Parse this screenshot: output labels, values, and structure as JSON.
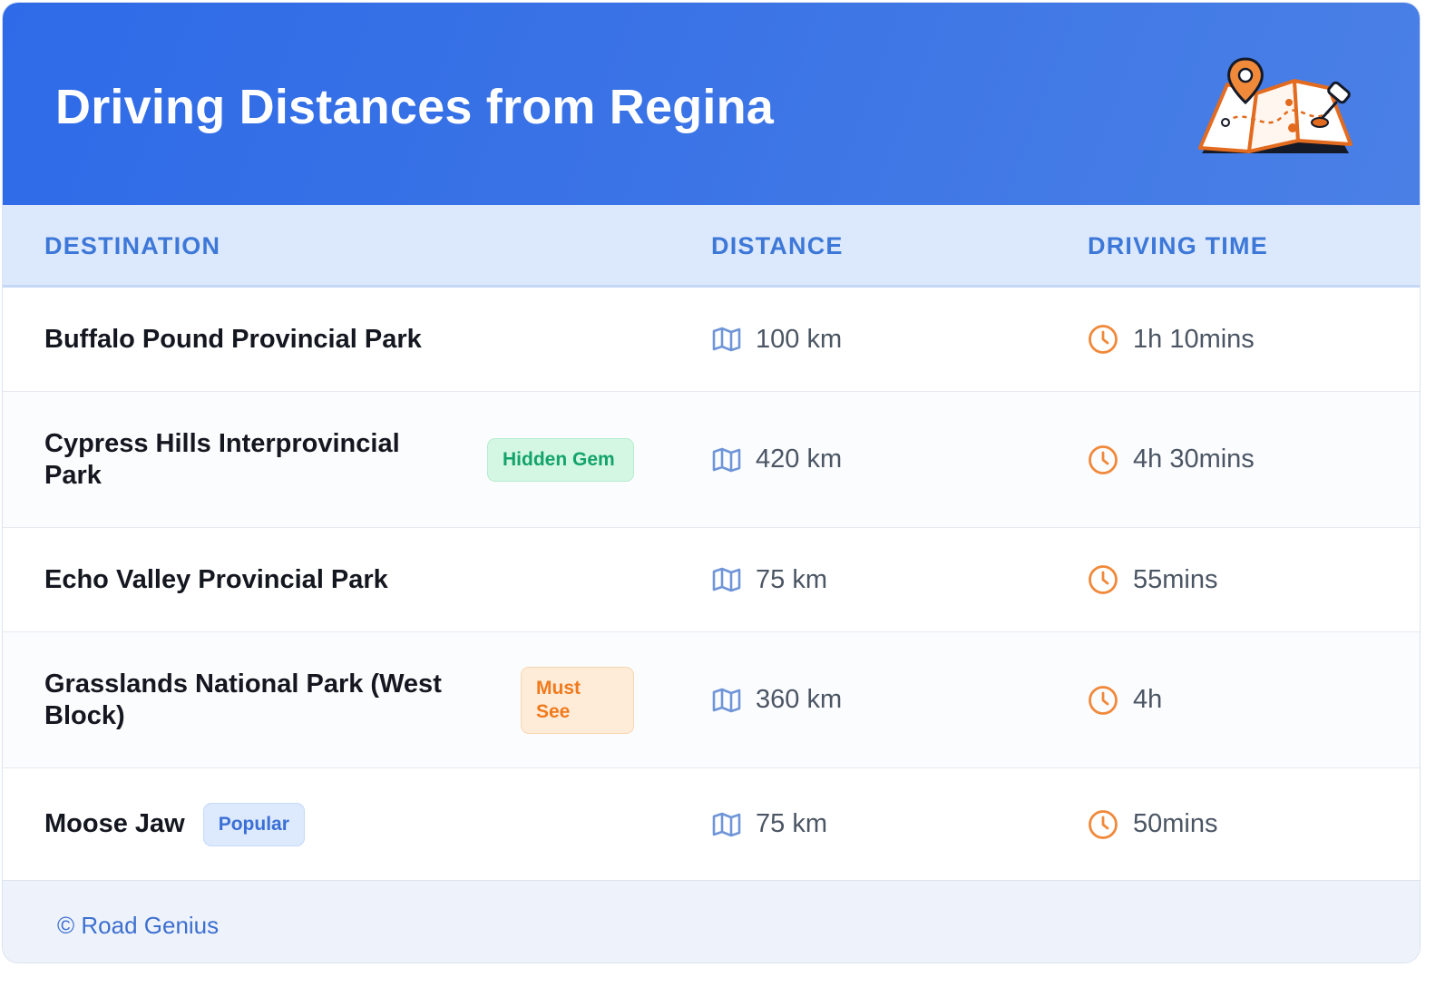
{
  "header": {
    "title": "Driving Distances from Regina",
    "illustration_icon": "folded-map-with-pin-icon",
    "gradient_start": "#2f6be8",
    "gradient_end": "#4a80e6"
  },
  "table": {
    "columns": {
      "destination": "DESTINATION",
      "distance": "DISTANCE",
      "driving_time": "DRIVING TIME"
    },
    "distance_icon": "map-icon",
    "time_icon": "clock-icon",
    "rows": [
      {
        "destination": "Buffalo Pound Provincial Park",
        "badge": null,
        "distance": "100 km",
        "driving_time": "1h 10mins"
      },
      {
        "destination": "Cypress Hills Interprovincial Park",
        "badge": "Hidden Gem",
        "badge_color": "#13a36a",
        "distance": "420 km",
        "driving_time": "4h 30mins"
      },
      {
        "destination": "Echo Valley Provincial Park",
        "badge": null,
        "distance": "75 km",
        "driving_time": "55mins"
      },
      {
        "destination": "Grasslands National Park (West Block)",
        "badge": "Must See",
        "badge_color": "#f07a1c",
        "distance": "360 km",
        "driving_time": "4h"
      },
      {
        "destination": "Moose Jaw",
        "badge": "Popular",
        "badge_color": "#3a6fd6",
        "distance": "75 km",
        "driving_time": "50mins"
      }
    ]
  },
  "footer": {
    "credit": "© Road Genius"
  },
  "colors": {
    "accent_blue": "#3d78d8",
    "clock_orange": "#f0893a",
    "map_icon_blue": "#6f95d8"
  }
}
